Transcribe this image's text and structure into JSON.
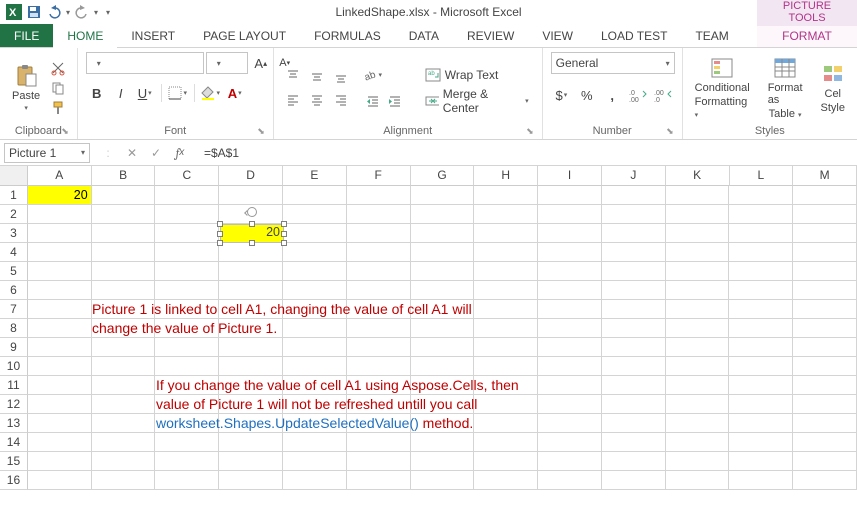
{
  "titlebar": {
    "doc_title": "LinkedShape.xlsx - Microsoft Excel",
    "contextual_title": "PICTURE TOOLS"
  },
  "tabs": {
    "file": "FILE",
    "home": "HOME",
    "insert": "INSERT",
    "page_layout": "PAGE LAYOUT",
    "formulas": "FORMULAS",
    "data": "DATA",
    "review": "REVIEW",
    "view": "VIEW",
    "load_test": "LOAD TEST",
    "team": "TEAM",
    "format": "FORMAT"
  },
  "ribbon": {
    "clipboard": {
      "paste": "Paste",
      "group": "Clipboard"
    },
    "font": {
      "group": "Font"
    },
    "alignment": {
      "wrap": "Wrap Text",
      "merge": "Merge & Center",
      "group": "Alignment"
    },
    "number": {
      "format": "General",
      "group": "Number"
    },
    "styles": {
      "conditional": "Conditional",
      "conditional2": "Formatting",
      "formatas": "Format as",
      "formatas2": "Table",
      "cellstyles": "Cel",
      "cellstyles2": "Style",
      "group": "Styles"
    }
  },
  "formulabar": {
    "name": "Picture 1",
    "dots": ":",
    "formula": "=$A$1"
  },
  "grid": {
    "columns": [
      "A",
      "B",
      "C",
      "D",
      "E",
      "F",
      "G",
      "H",
      "I",
      "J",
      "K",
      "L",
      "M"
    ],
    "rows": [
      "1",
      "2",
      "3",
      "4",
      "5",
      "6",
      "7",
      "8",
      "9",
      "10",
      "11",
      "12",
      "13",
      "14",
      "15",
      "16"
    ],
    "A1": "20",
    "linked_shape_value": "20",
    "note1_line1": "Picture 1 is linked to cell A1, changing the value of cell A1 will",
    "note1_line2": "change the value of Picture 1.",
    "note2_line1": "If you change the value of cell A1 using Aspose.Cells, then",
    "note2_line2": "value of Picture 1 will not be refreshed untill you call",
    "note2_code": "worksheet.Shapes.UpdateSelectedValue()",
    "note2_tail": " method."
  }
}
